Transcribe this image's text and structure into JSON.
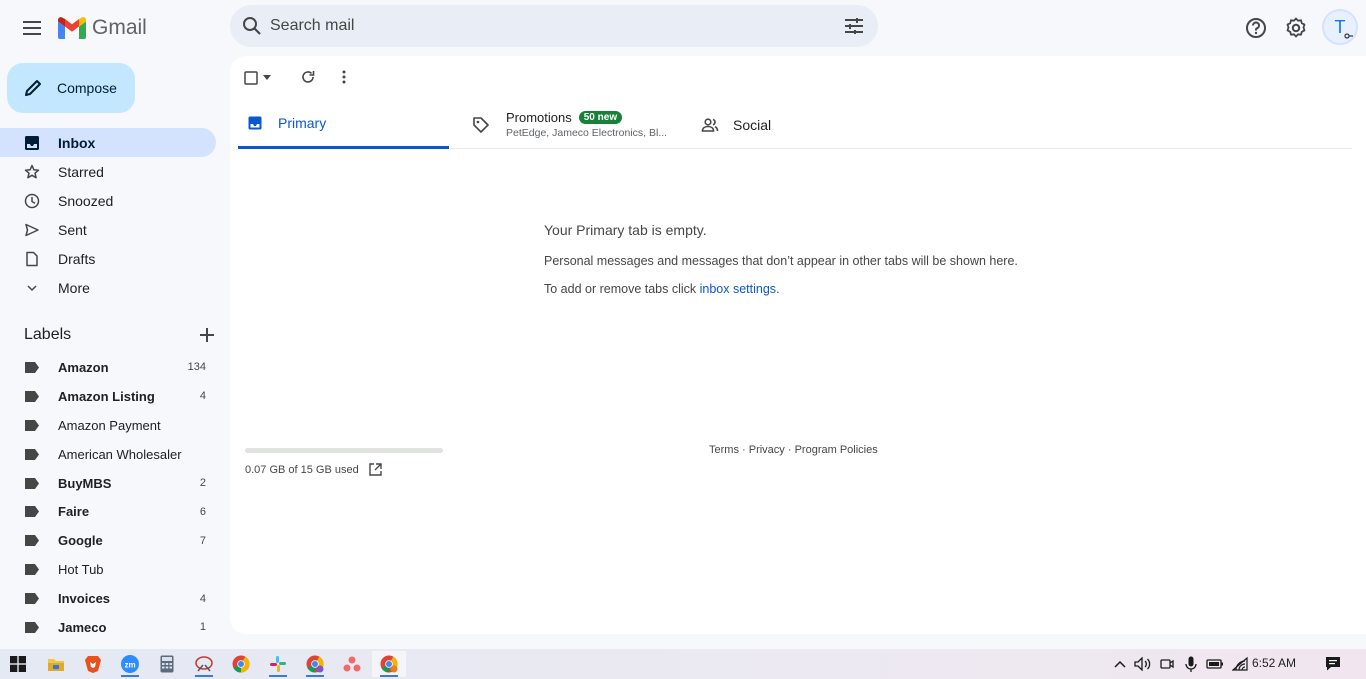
{
  "header": {
    "app_name": "Gmail",
    "search_placeholder": "Search mail",
    "avatar_initial": "T"
  },
  "sidebar": {
    "compose_label": "Compose",
    "nav": [
      {
        "label": "Inbox",
        "icon": "inbox-icon",
        "active": true
      },
      {
        "label": "Starred",
        "icon": "star-icon"
      },
      {
        "label": "Snoozed",
        "icon": "clock-icon"
      },
      {
        "label": "Sent",
        "icon": "send-icon"
      },
      {
        "label": "Drafts",
        "icon": "draft-icon"
      },
      {
        "label": "More",
        "icon": "chevron-down-icon"
      }
    ],
    "labels_title": "Labels",
    "labels": [
      {
        "name": "Amazon",
        "count": "134",
        "bold": true
      },
      {
        "name": "Amazon Listing",
        "count": "4",
        "bold": true
      },
      {
        "name": "Amazon Payment",
        "count": "",
        "bold": false
      },
      {
        "name": "American Wholesaler",
        "count": "",
        "bold": false
      },
      {
        "name": "BuyMBS",
        "count": "2",
        "bold": true
      },
      {
        "name": "Faire",
        "count": "6",
        "bold": true
      },
      {
        "name": "Google",
        "count": "7",
        "bold": true
      },
      {
        "name": "Hot Tub",
        "count": "",
        "bold": false
      },
      {
        "name": "Invoices",
        "count": "4",
        "bold": true
      },
      {
        "name": "Jameco",
        "count": "1",
        "bold": true
      }
    ]
  },
  "tabs": {
    "primary": "Primary",
    "promotions": "Promotions",
    "promotions_badge": "50 new",
    "promotions_senders": "PetEdge, Jameco Electronics, Bl...",
    "social": "Social"
  },
  "empty_state": {
    "title": "Your Primary tab is empty.",
    "line1": "Personal messages and messages that don’t appear in other tabs will be shown here.",
    "line2_prefix": "To add or remove tabs click ",
    "line2_link": "inbox settings",
    "line2_suffix": "."
  },
  "storage": {
    "text": "0.07 GB of 15 GB used",
    "fraction": 0.005
  },
  "footer": {
    "terms": "Terms",
    "privacy": "Privacy",
    "policies": "Program Policies",
    "sep": " · "
  },
  "taskbar": {
    "time": "6:52 AM"
  },
  "colors": {
    "accent": "#0b57d0",
    "compose": "#c2e7ff",
    "active_nav": "#d3e3fd",
    "badge": "#188038"
  }
}
